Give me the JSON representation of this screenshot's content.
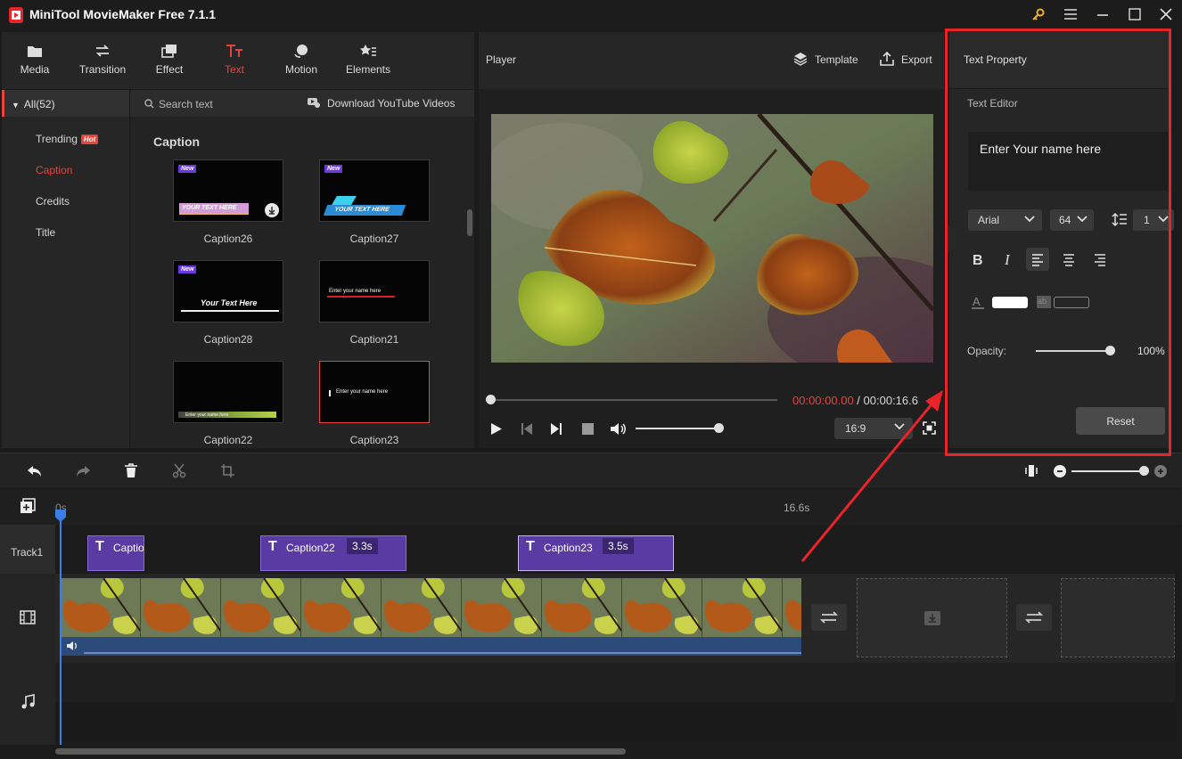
{
  "app": {
    "title": "MiniTool MovieMaker Free 7.1.1"
  },
  "toolbar": {
    "items": [
      {
        "label": "Media"
      },
      {
        "label": "Transition"
      },
      {
        "label": "Effect"
      },
      {
        "label": "Text"
      },
      {
        "label": "Motion"
      },
      {
        "label": "Elements"
      }
    ]
  },
  "sidebar": {
    "all_label": "All(52)",
    "items": [
      {
        "label": "Trending",
        "badge": "Hot"
      },
      {
        "label": "Caption"
      },
      {
        "label": "Credits"
      },
      {
        "label": "Title"
      }
    ]
  },
  "library": {
    "search_placeholder": "Search text",
    "download_label": "Download YouTube Videos",
    "section_title": "Caption",
    "new_badge": "New",
    "items": [
      {
        "name": "Caption26",
        "text": "YOUR TEXT HERE"
      },
      {
        "name": "Caption27",
        "text": "YOUR TEXT HERE"
      },
      {
        "name": "Caption28",
        "text": "Your Text Here"
      },
      {
        "name": "Caption21",
        "text": "Enter your name here"
      },
      {
        "name": "Caption22",
        "text": "Enter your name here"
      },
      {
        "name": "Caption23",
        "text": "Enter your name here"
      }
    ]
  },
  "player": {
    "title": "Player",
    "template_label": "Template",
    "export_label": "Export",
    "current_time": "00:00:00.00",
    "separator": " / ",
    "total_time": "00:00:16.6",
    "aspect_ratio": "16:9",
    "progress": 0,
    "volume": 0.9
  },
  "text_property": {
    "title": "Text Property",
    "editor_label": "Text Editor",
    "editor_text": "Enter Your name here",
    "font": "Arial",
    "size": "64",
    "line_spacing": "1",
    "opacity_label": "Opacity:",
    "opacity_value": "100%",
    "opacity": 1.0,
    "reset_label": "Reset",
    "text_color": "#ffffff"
  },
  "timeline": {
    "ruler_start": "0s",
    "ruler_end": "16.6s",
    "track_label": "Track1",
    "clips": [
      {
        "name": "Caption",
        "duration": ""
      },
      {
        "name": "Caption22",
        "duration": "3.3s"
      },
      {
        "name": "Caption23",
        "duration": "3.5s"
      }
    ]
  },
  "colors": {
    "accent": "#e8423c",
    "highlight_box": "#e8232a",
    "clip_purple": "#5a3aa3"
  }
}
